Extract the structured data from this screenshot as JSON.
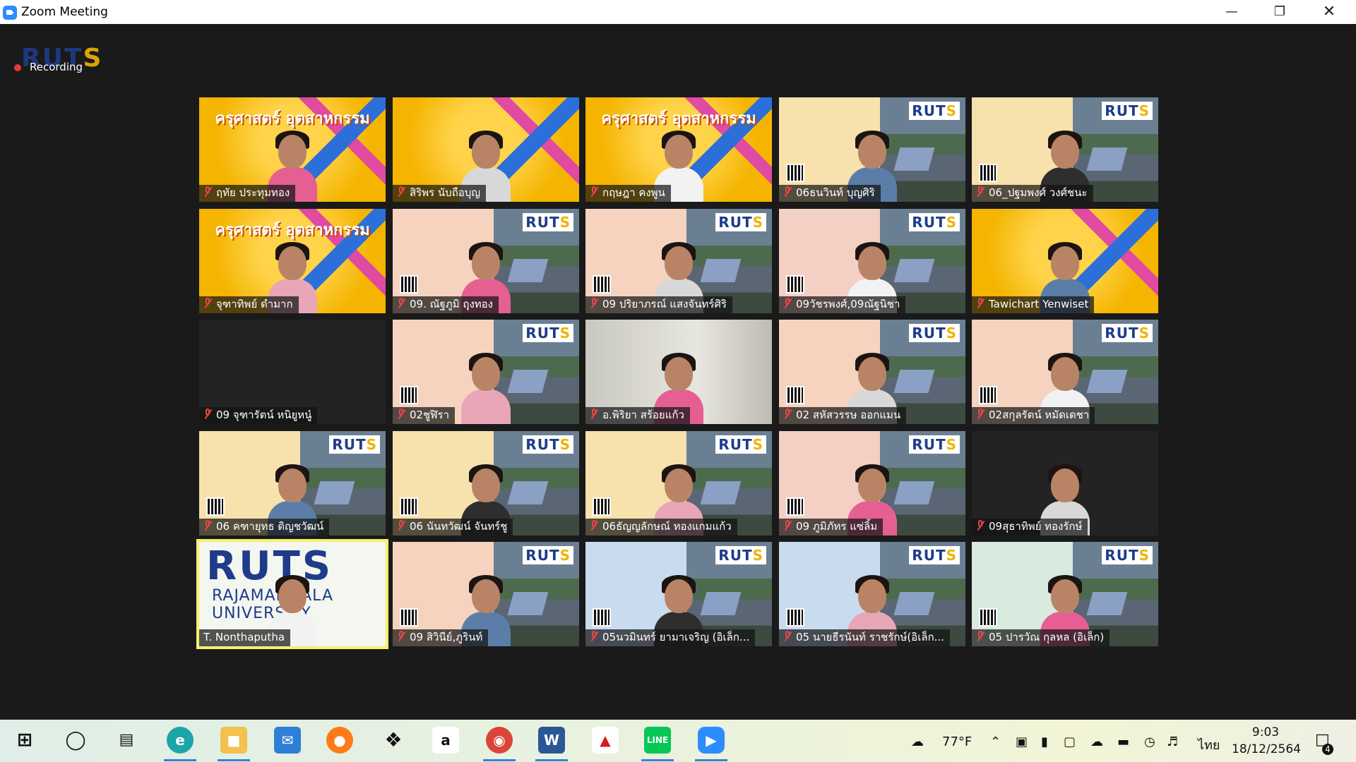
{
  "window": {
    "title": "Zoom Meeting"
  },
  "meeting": {
    "recording_label": "Recording",
    "watermark": "RUTS"
  },
  "participants": [
    {
      "name": "ฤทัย ประทุมทอง",
      "bg": "yellow",
      "muted": true,
      "banner": "ครุศาสตร์ อุตสาหกรรม"
    },
    {
      "name": "สิริพร นับถือบุญ",
      "bg": "yellow",
      "muted": true,
      "banner": ""
    },
    {
      "name": "กฤษฎา คงพูน",
      "bg": "yellow",
      "muted": true,
      "banner": "ครุศาสตร์ อุตสาหกรรม"
    },
    {
      "name": "06ธนวินท์ บุญศิริ",
      "bg": "cream",
      "muted": true
    },
    {
      "name": "06_ปฐมพงศ์ วงศ์ชนะ",
      "bg": "cream",
      "muted": true
    },
    {
      "name": "จุฑาทิพย์ ดำมาก",
      "bg": "yellow",
      "muted": true,
      "banner": "ครุศาสตร์ อุตสาหกรรม"
    },
    {
      "name": "09. ณัฐภูมิ ฤุงทอง",
      "bg": "peach",
      "muted": true
    },
    {
      "name": "09 ปริยาภรณ์ แสงจันทร์ศิริ",
      "bg": "peach",
      "muted": true
    },
    {
      "name": "09วัชรพงศ์,09ณัฐนิชา",
      "bg": "pink",
      "muted": true
    },
    {
      "name": "Tawichart Yenwiset",
      "bg": "yellow",
      "muted": true,
      "banner": ""
    },
    {
      "name": "09 จุฑารัตน์ หนิยูหนู๋",
      "bg": "black",
      "muted": true
    },
    {
      "name": "02ชูฬิรา",
      "bg": "peach",
      "muted": true
    },
    {
      "name": "อ.พิริยา สร้อยแก้ว",
      "bg": "room",
      "muted": true
    },
    {
      "name": "02 สหัสวรรษ ออกแมน",
      "bg": "peach",
      "muted": true
    },
    {
      "name": "02สกุลรัตน์ หมัดเดชา",
      "bg": "peach",
      "muted": true
    },
    {
      "name": "06 คฑายุทธ ดิญชวัฒน์",
      "bg": "cream",
      "muted": true
    },
    {
      "name": "06 นันทวัฒน์ จันทร์ชู",
      "bg": "cream",
      "muted": true
    },
    {
      "name": "06ธัญญลักษณ์ ทองแกมแก้ว",
      "bg": "cream",
      "muted": true
    },
    {
      "name": "09 ภูมิภัทร แซ่ลิ้ม",
      "bg": "pink",
      "muted": true
    },
    {
      "name": "09สุธาทิพย์ ทองรักษ์",
      "bg": "black",
      "muted": true
    },
    {
      "name": "T. Nonthaputha",
      "bg": "white",
      "muted": false,
      "active": true
    },
    {
      "name": "09 สิวินีย์,ภูรินท์",
      "bg": "peach",
      "muted": true
    },
    {
      "name": "05นวมินทร์ ยามาเจริญ (อิเล็ก...",
      "bg": "blue",
      "muted": true
    },
    {
      "name": "05 นายธีรนันท์ ราชรักษ์(อิเล็ก...",
      "bg": "blue",
      "muted": true
    },
    {
      "name": "05 ปารวัณ กุลหล (อิเล็ก)",
      "bg": "mint",
      "muted": true
    }
  ],
  "active_logo": {
    "line1": "RUTS",
    "line2": "RAJAMANGALA UNIVERSITY"
  },
  "taskbar": {
    "weather": "77°F",
    "language": "ไทย",
    "time": "9:03",
    "date": "18/12/2564",
    "notifications": "4",
    "apps": [
      "windows-start",
      "search",
      "task-view",
      "edge",
      "file-explorer",
      "mail",
      "firefox",
      "dropbox",
      "amazon",
      "chrome",
      "word",
      "acrobat",
      "line",
      "zoom"
    ]
  },
  "colors": {
    "accent": "#2d8cff",
    "active_speaker": "#f6f06b",
    "mute_red": "#e44444"
  }
}
